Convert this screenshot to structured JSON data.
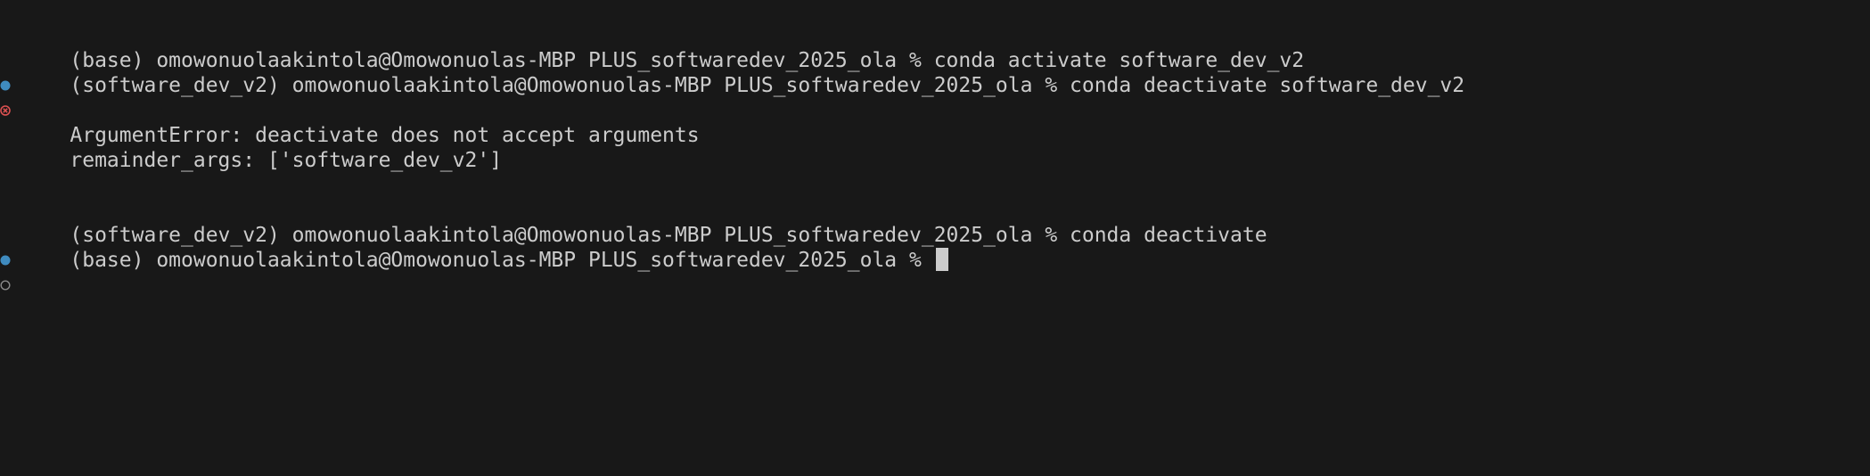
{
  "colors": {
    "background": "#181818",
    "foreground": "#cccccc",
    "success_decoration": "#3f8bbf",
    "error_decoration": "#e05252",
    "pending_decoration": "#8a8a8a"
  },
  "lines": [
    {
      "decoration": "success-dot-icon",
      "text": "(base) omowonuolaakintola@Omowonuolas-MBP PLUS_softwaredev_2025_ola % conda activate software_dev_v2"
    },
    {
      "decoration": "error-circle-x-icon",
      "text": "(software_dev_v2) omowonuolaakintola@Omowonuolas-MBP PLUS_softwaredev_2025_ola % conda deactivate software_dev_v2"
    },
    {
      "text": "ArgumentError: deactivate does not accept arguments"
    },
    {
      "text": "remainder_args: ['software_dev_v2']"
    },
    {
      "decoration": "success-dot-icon",
      "text": "(software_dev_v2) omowonuolaakintola@Omowonuolas-MBP PLUS_softwaredev_2025_ola % conda deactivate"
    },
    {
      "decoration": "pending-ring-icon",
      "text": "(base) omowonuolaakintola@Omowonuolas-MBP PLUS_softwaredev_2025_ola % "
    }
  ]
}
